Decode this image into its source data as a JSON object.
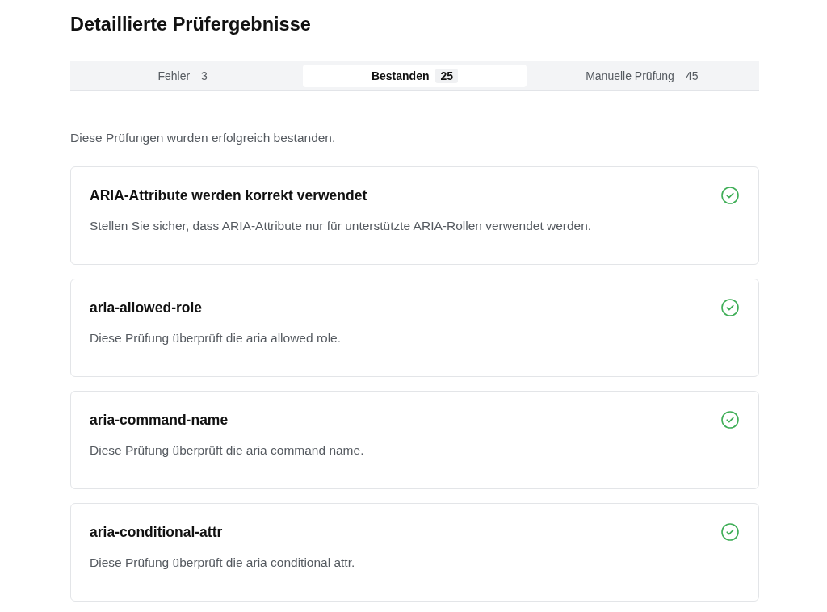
{
  "heading": "Detaillierte Prüfergebnisse",
  "tabs": [
    {
      "label": "Fehler",
      "count": "3",
      "selected": false
    },
    {
      "label": "Bestanden",
      "count": "25",
      "selected": true
    },
    {
      "label": "Manuelle Prüfung",
      "count": "45",
      "selected": false
    }
  ],
  "intro": "Diese Prüfungen wurden erfolgreich bestanden.",
  "checks": [
    {
      "title": "ARIA-Attribute werden korrekt verwendet",
      "description": "Stellen Sie sicher, dass ARIA-Attribute nur für unterstützte ARIA-Rollen verwendet werden.",
      "passed": true
    },
    {
      "title": "aria-allowed-role",
      "description": "Diese Prüfung überprüft die aria allowed role.",
      "passed": true
    },
    {
      "title": "aria-command-name",
      "description": "Diese Prüfung überprüft die aria command name.",
      "passed": true
    },
    {
      "title": "aria-conditional-attr",
      "description": "Diese Prüfung überprüft die aria conditional attr.",
      "passed": true
    }
  ]
}
